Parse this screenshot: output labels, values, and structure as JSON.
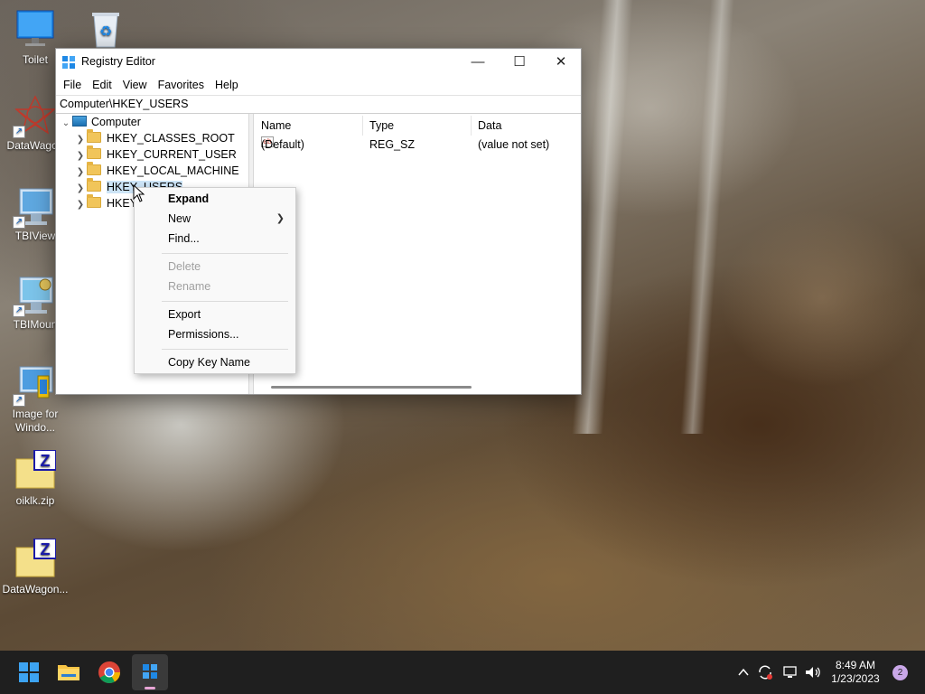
{
  "desktop": {
    "icons": [
      {
        "label": "Toilet"
      },
      {
        "label": ""
      },
      {
        "label": "DataWagon"
      },
      {
        "label": "TBIView"
      },
      {
        "label": "TBIMoun"
      },
      {
        "label": "Image for Windo..."
      },
      {
        "label": "oiklk.zip"
      },
      {
        "label": "DataWagon..."
      }
    ]
  },
  "window": {
    "title": "Registry Editor",
    "menu": [
      "File",
      "Edit",
      "View",
      "Favorites",
      "Help"
    ],
    "address": "Computer\\HKEY_USERS",
    "tree": {
      "root": "Computer",
      "keys": [
        "HKEY_CLASSES_ROOT",
        "HKEY_CURRENT_USER",
        "HKEY_LOCAL_MACHINE",
        "HKEY_USERS",
        "HKEY_CURRENT_CONFIG"
      ],
      "selected": "HKEY_USERS"
    },
    "columns": [
      "Name",
      "Type",
      "Data"
    ],
    "rows": [
      {
        "name": "(Default)",
        "type": "REG_SZ",
        "data": "(value not set)"
      }
    ]
  },
  "context_menu": {
    "items": [
      {
        "label": "Expand",
        "bold": true,
        "enabled": true
      },
      {
        "label": "New",
        "submenu": true,
        "enabled": true
      },
      {
        "label": "Find...",
        "enabled": true
      },
      {
        "label": "Delete",
        "enabled": false
      },
      {
        "label": "Rename",
        "enabled": false
      },
      {
        "label": "Export",
        "enabled": true
      },
      {
        "label": "Permissions...",
        "enabled": true
      },
      {
        "label": "Copy Key Name",
        "enabled": true
      }
    ]
  },
  "taskbar": {
    "apps": [
      "start",
      "file-explorer",
      "chrome",
      "registry-editor"
    ],
    "clock": {
      "time": "8:49 AM",
      "date": "1/23/2023"
    },
    "notification_count": "2"
  },
  "colors": {
    "selection": "#cce4f7",
    "taskbar": "#1f1f1f",
    "accent": "#0078d4"
  }
}
